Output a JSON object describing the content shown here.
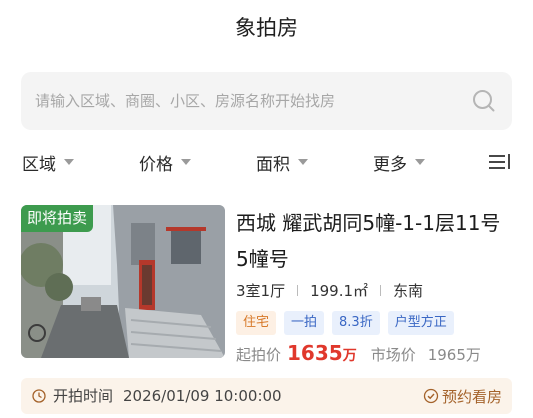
{
  "header": {
    "title": "象拍房"
  },
  "search": {
    "placeholder": "请输入区域、商圈、小区、房源名称开始找房",
    "value": ""
  },
  "filters": [
    {
      "label": "区域"
    },
    {
      "label": "价格"
    },
    {
      "label": "面积"
    },
    {
      "label": "更多"
    }
  ],
  "listing": {
    "badge": "即将拍卖",
    "title": "西城 耀武胡同5幢-1-1层11号5幢号",
    "layout": "3室1厅",
    "area": "199.1㎡",
    "orientation": "东南",
    "tags": [
      "住宅",
      "一拍",
      "8.3折",
      "户型方正"
    ],
    "start_price_label": "起拍价",
    "start_price": "1635",
    "start_price_unit": "万",
    "market_price_label": "市场价",
    "market_price": "1965万",
    "auction_label": "开拍时间",
    "auction_time": "2026/01/09 10:00:00",
    "reserve_label": "预约看房"
  },
  "colors": {
    "badge": "#3d9b4e",
    "price": "#e0382c",
    "tag_orange": "#d77a2b",
    "tag_blue": "#3a67c4",
    "strip_bg": "#fbf3ea"
  }
}
